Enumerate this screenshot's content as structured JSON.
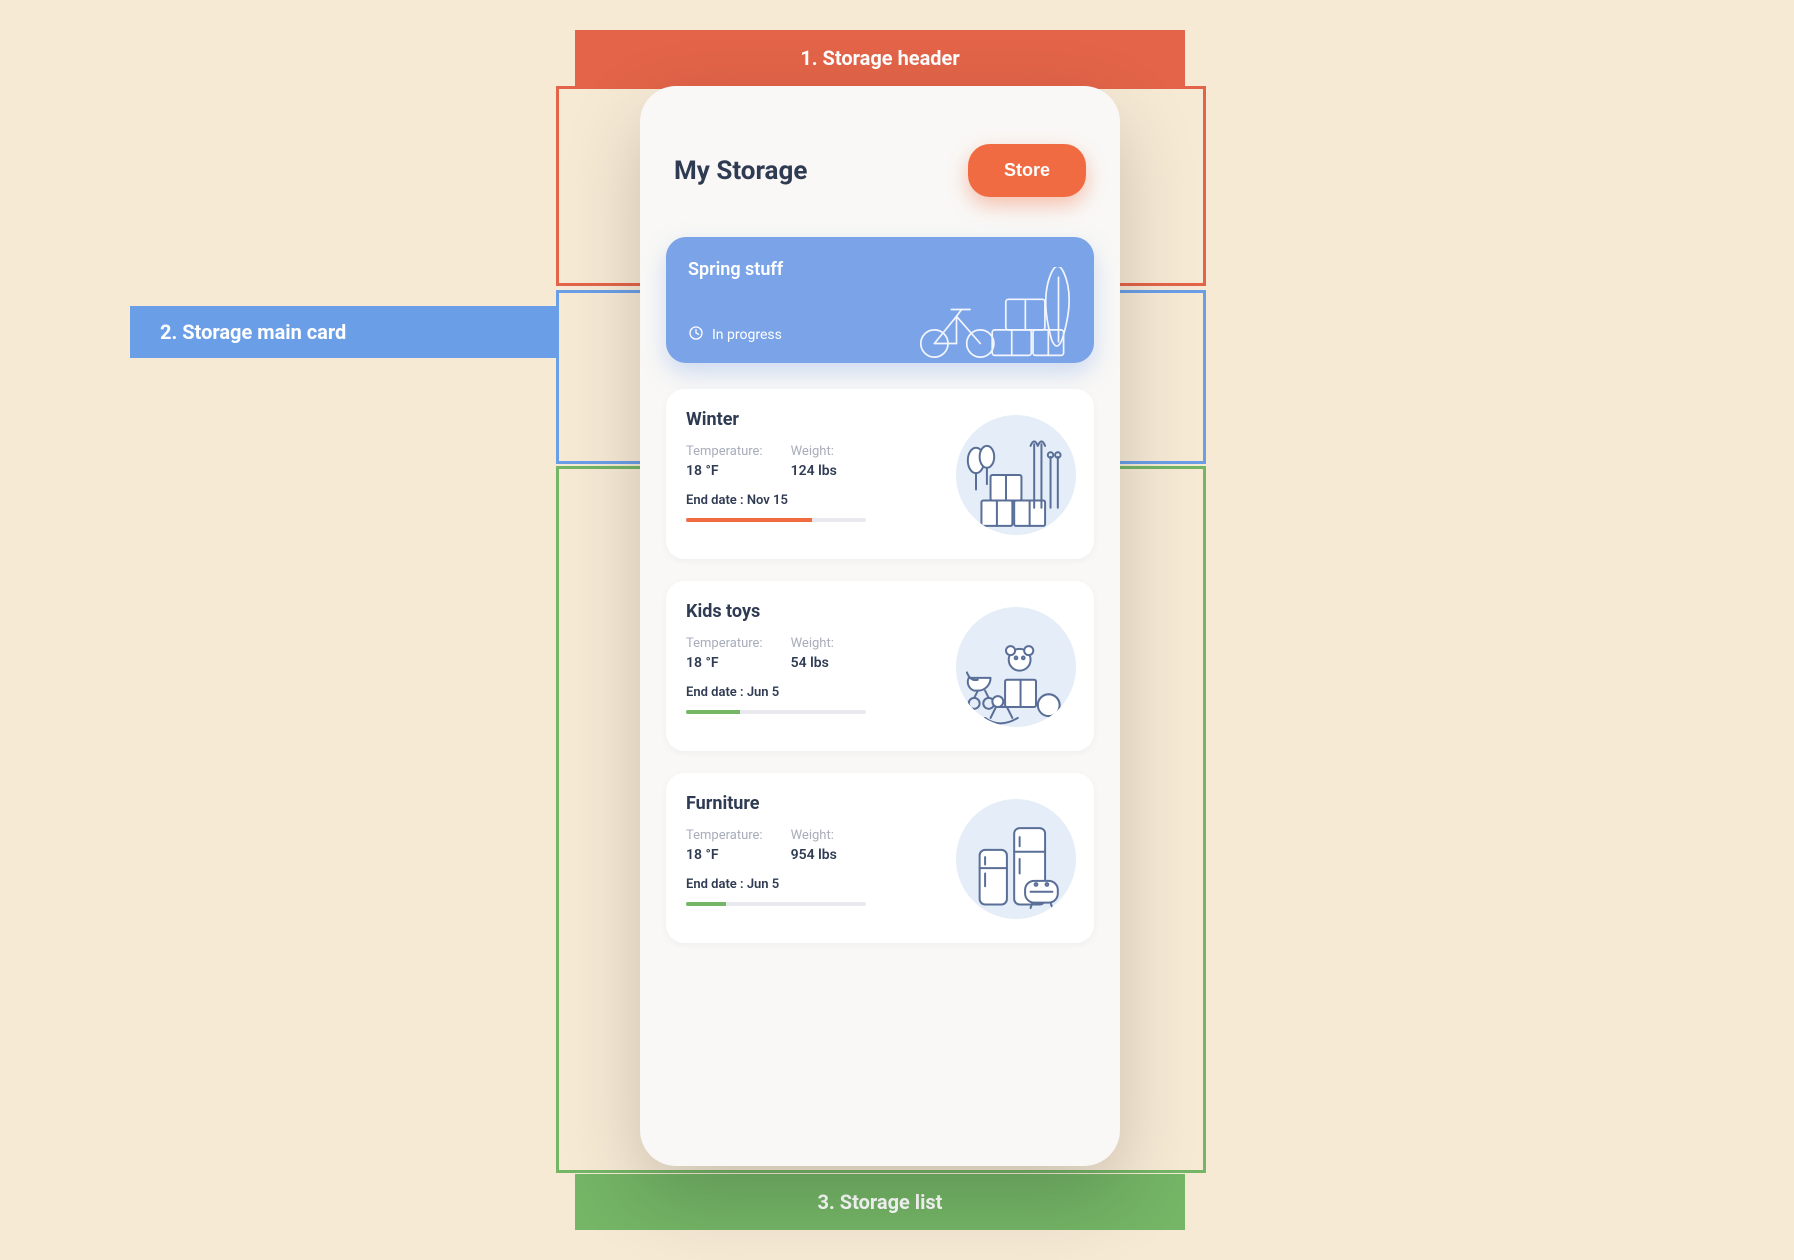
{
  "annotations": {
    "top": "1. Storage header",
    "left": "2. Storage main card",
    "bottom": "3. Storage list"
  },
  "header": {
    "title": "My Storage",
    "button": "Store"
  },
  "main_card": {
    "title": "Spring stuff",
    "status": "In progress",
    "art": "bike-boxes-surf-icon"
  },
  "labels": {
    "temperature": "Temperature:",
    "weight": "Weight:",
    "end_prefix": "End date : "
  },
  "items": [
    {
      "name": "Winter",
      "temperature": "18 °F",
      "weight": "124 lbs",
      "end_date": "Nov 15",
      "progress_pct": 70,
      "progress_color": "orange",
      "art": "ski-boxes-icon"
    },
    {
      "name": "Kids toys",
      "temperature": "18 °F",
      "weight": "54 lbs",
      "end_date": "Jun 5",
      "progress_pct": 30,
      "progress_color": "green",
      "art": "toys-stroller-icon"
    },
    {
      "name": "Furniture",
      "temperature": "18 °F",
      "weight": "954 lbs",
      "end_date": "Jun 5",
      "progress_pct": 22,
      "progress_color": "green",
      "art": "furniture-fridge-sofa-icon"
    }
  ],
  "colors": {
    "accent_orange": "#f16b42",
    "accent_blue": "#7aa3e8",
    "accent_green": "#74b566",
    "canvas": "#f7ead5"
  }
}
